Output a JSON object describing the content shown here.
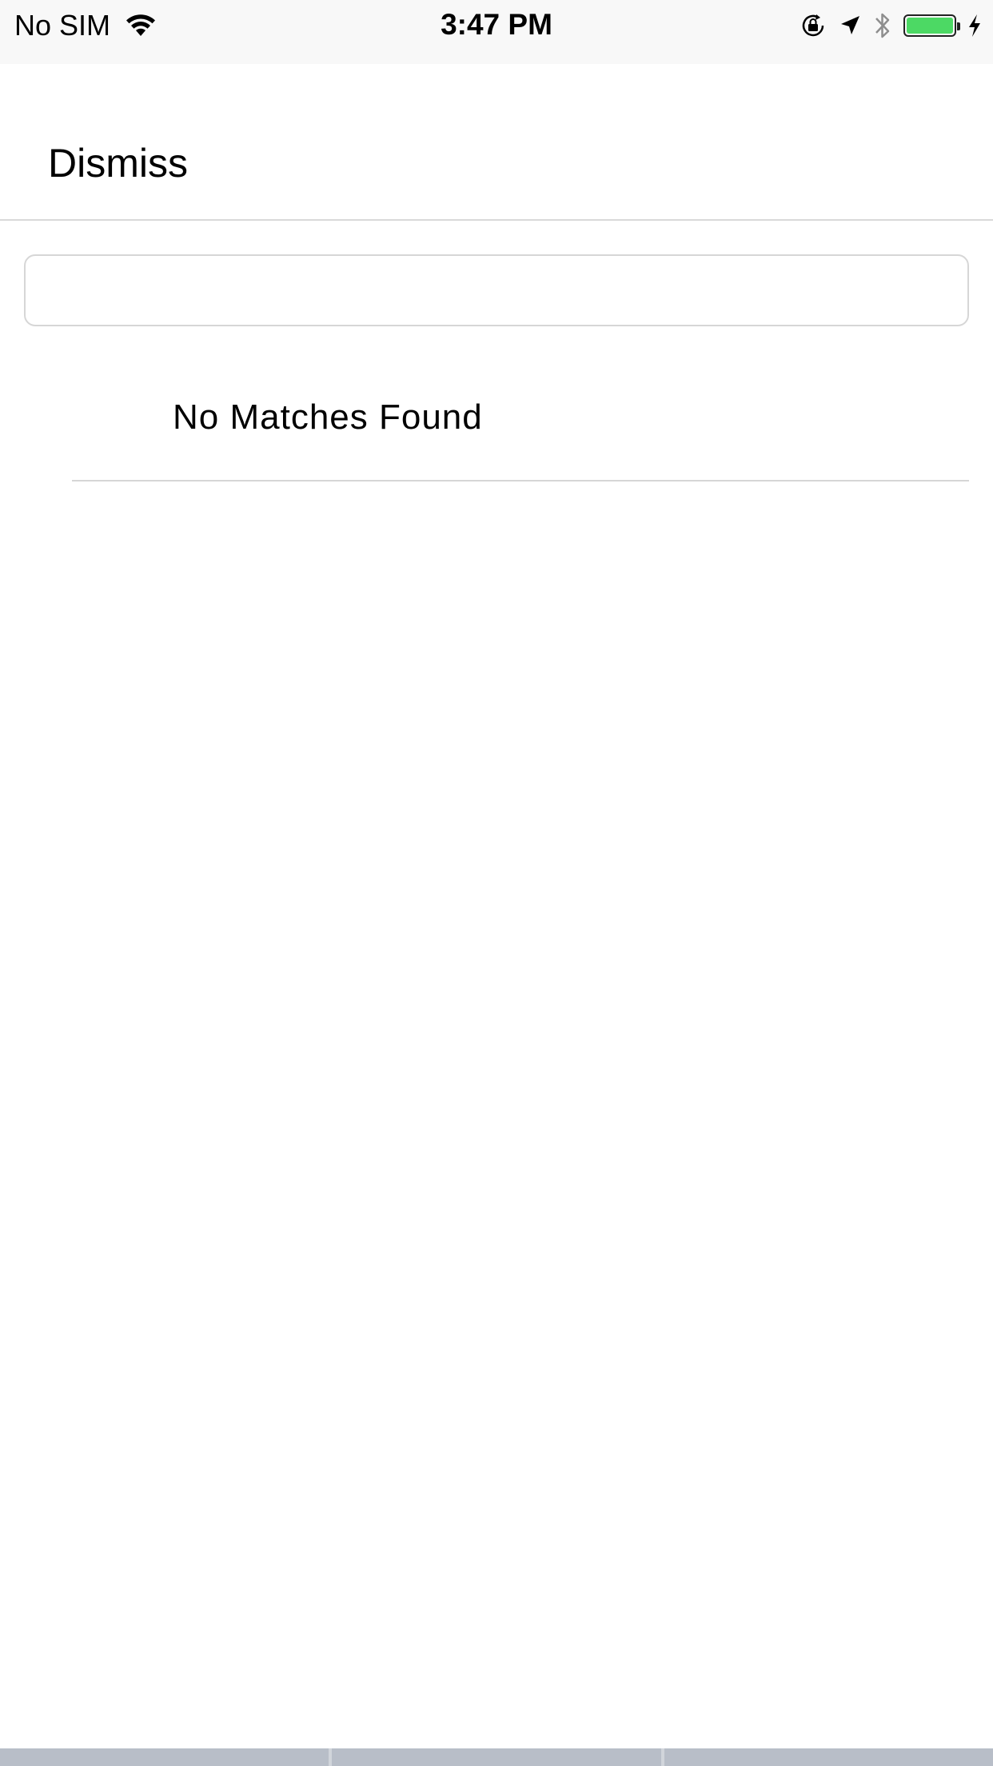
{
  "status_bar": {
    "carrier": "No SIM",
    "time": "3:47 PM",
    "icons": [
      "wifi-icon",
      "orientation-lock-icon",
      "location-arrow-icon",
      "bluetooth-icon",
      "battery-icon",
      "charging-bolt-icon"
    ],
    "battery_color": "#4cd964",
    "battery_level": 1.0
  },
  "nav": {
    "dismiss_label": "Dismiss"
  },
  "search": {
    "value": "",
    "placeholder": ""
  },
  "results": {
    "empty_message": "No Matches Found"
  },
  "colors": {
    "separator": "#d6d6d6",
    "status_bar_bg": "#f8f8f8",
    "keyboard_bg": "#b8bec8"
  }
}
